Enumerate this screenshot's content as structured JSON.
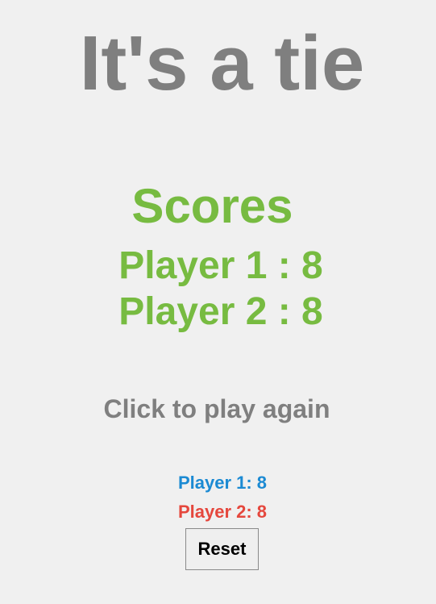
{
  "game": {
    "result_title": "It's a tie",
    "scores_heading": "Scores",
    "player1_score_line": "Player 1 : 8",
    "player2_score_line": "Player 2 : 8",
    "play_again_text": "Click to play again"
  },
  "scoreboard": {
    "player1_label": "Player 1: 8",
    "player2_label": "Player 2: 8",
    "reset_label": "Reset"
  },
  "colors": {
    "title_gray": "#7f7f7f",
    "score_green": "#77bb41",
    "player1_blue": "#1b8ad3",
    "player2_red": "#e5473d",
    "background": "#f0f0f0"
  }
}
